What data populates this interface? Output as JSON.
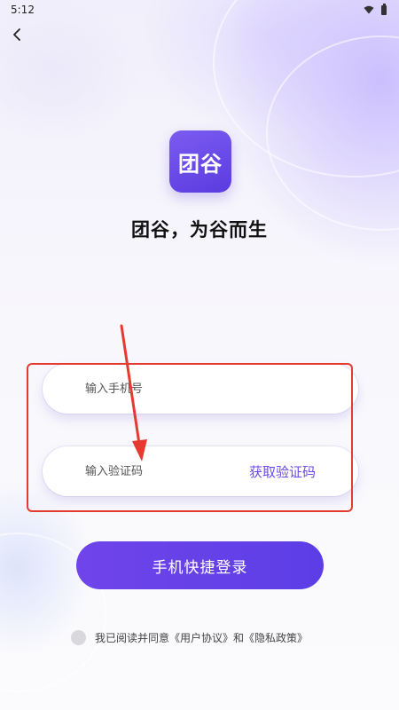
{
  "status_bar": {
    "time": "5:12"
  },
  "logo": {
    "text": "团谷"
  },
  "slogan": "团谷，为谷而生",
  "form": {
    "phone_placeholder": "输入手机号",
    "code_placeholder": "输入验证码",
    "get_code_label": "获取验证码"
  },
  "login_button": "手机快捷登录",
  "agreement": {
    "prefix": "我已阅读并同意",
    "user_agreement": "《用户协议》",
    "and": "和",
    "privacy_policy": "《隐私政策》"
  },
  "icons": [
    "back-arrow-icon",
    "wifi-icon",
    "battery-icon"
  ],
  "colors": {
    "brand": "#5a3be0",
    "accent": "#6a4ae6",
    "annotation": "#e53a2f"
  }
}
